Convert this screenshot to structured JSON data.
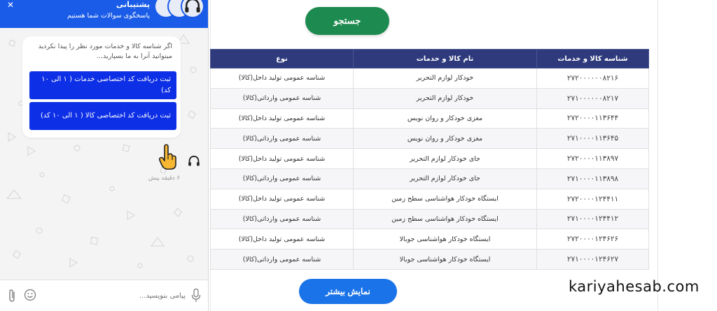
{
  "chat": {
    "header_title": "پشتیبانی",
    "header_subtitle": "پاسخگوی سوالات شما هستیم",
    "message": "اگر شناسه کالا و خدمات مورد نظر را پیدا نکردید میتوانید آنرا به ما بسپارید...",
    "option_services": "ثبت دریافت کد اختصاصی خدمات ( ۱ الی ۱۰ کد)",
    "option_goods": "ثبت دریافت کد اختصاصی کالا ( ۱ الی ۱۰ کد)",
    "time": "۶ دقیقه پیش",
    "input_placeholder": "پیامی بنویسید...",
    "icons": {
      "close": "close-icon",
      "agent": "headset-icon",
      "hand": "hand-pointer-icon",
      "mic": "microphone-icon",
      "emoji": "emoji-icon",
      "attach": "paperclip-icon"
    }
  },
  "search": {
    "button_label": "جستجو"
  },
  "table": {
    "headers": [
      "شناسه کالا و خدمات",
      "نام کالا و خدمات",
      "نوع"
    ],
    "rows": [
      [
        "۲۷۲۰۰۰۰۰۰۸۲۱۶",
        "خودکار لوازم التحریر",
        "شناسه عمومی تولید داخل(کالا)"
      ],
      [
        "۲۷۱۰۰۰۰۰۰۸۲۱۷",
        "خودکار لوازم التحریر",
        "شناسه عمومی وارداتی(کالا)"
      ],
      [
        "۲۷۲۰۰۰۰۱۱۳۶۴۴",
        "مغزی خودکار و روان نویس",
        "شناسه عمومی تولید داخل(کالا)"
      ],
      [
        "۲۷۱۰۰۰۰۱۱۳۶۴۵",
        "مغزی خودکار و روان نویس",
        "شناسه عمومی وارداتی(کالا)"
      ],
      [
        "۲۷۲۰۰۰۰۱۱۳۸۹۷",
        "جای خودکار لوازم التحریر",
        "شناسه عمومی تولید داخل(کالا)"
      ],
      [
        "۲۷۱۰۰۰۰۱۱۳۸۹۸",
        "جای خودکار لوازم التحریر",
        "شناسه عمومی وارداتی(کالا)"
      ],
      [
        "۲۷۲۰۰۰۰۱۲۴۴۱۱",
        "ایستگاه خودکار هواشناسی سطح زمین",
        "شناسه عمومی تولید داخل(کالا)"
      ],
      [
        "۲۷۱۰۰۰۰۱۲۴۴۱۲",
        "ایستگاه خودکار هواشناسی سطح زمین",
        "شناسه عمومی وارداتی(کالا)"
      ],
      [
        "۲۷۲۰۰۰۰۱۲۴۶۲۶",
        "ایستگاه خودکار هواشناسی جوبالا",
        "شناسه عمومی تولید داخل(کالا)"
      ],
      [
        "۲۷۱۰۰۰۰۱۲۴۶۲۷",
        "ایستگاه خودکار هواشناسی جوبالا",
        "شناسه عمومی وارداتی(کالا)"
      ]
    ]
  },
  "more_button_label": "نمایش بیشتر",
  "watermark": "kariyahesab.com",
  "colors": {
    "header_blue": "#1a5ce8",
    "option_blue": "#0d2fe6",
    "table_header": "#2e3a7c",
    "search_green": "#1d8a4f",
    "more_blue": "#1a73e8"
  }
}
